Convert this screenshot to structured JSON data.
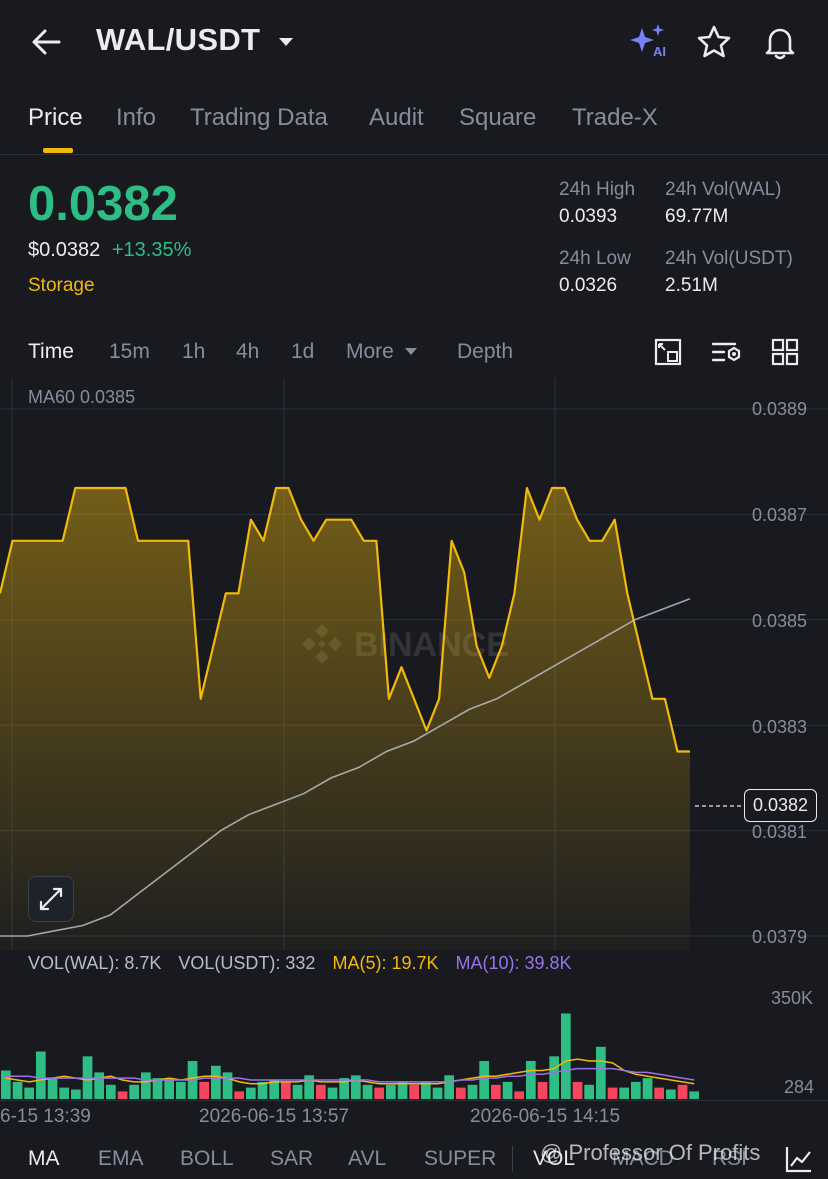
{
  "header": {
    "pair": "WAL/USDT"
  },
  "tabs": [
    "Price",
    "Info",
    "Trading Data",
    "Audit",
    "Square",
    "Trade-X"
  ],
  "ticker": {
    "price": "0.0382",
    "usd_price": "$0.0382",
    "change": "+13.35%",
    "tag": "Storage",
    "high_label": "24h High",
    "high": "0.0393",
    "vol_wal_label": "24h Vol(WAL)",
    "vol_wal": "69.77M",
    "low_label": "24h Low",
    "low": "0.0326",
    "vol_usdt_label": "24h Vol(USDT)",
    "vol_usdt": "2.51M"
  },
  "intervals": [
    "Time",
    "15m",
    "1h",
    "4h",
    "1d",
    "More",
    "Depth"
  ],
  "chart": {
    "ma_label": "MA60 0.0385",
    "watermark": "BINANCE",
    "current_price_label": "0.0382",
    "y_labels": [
      "0.0389",
      "0.0387",
      "0.0385",
      "0.0383",
      "0.0381",
      "0.0379"
    ],
    "vol_labels": [
      "350K",
      "284"
    ],
    "x_labels": [
      "6-15 13:39",
      "2026-06-15 13:57",
      "2026-06-15 14:15"
    ]
  },
  "volume_header": {
    "vol_wal": "VOL(WAL): 8.7K",
    "vol_usdt": "VOL(USDT): 332",
    "ma5": "MA(5): 19.7K",
    "ma10": "MA(10): 39.8K"
  },
  "indicators": [
    "MA",
    "EMA",
    "BOLL",
    "SAR",
    "AVL",
    "SUPER",
    "VOL",
    "MACD",
    "RSI"
  ],
  "watermark_credit": "@ Professor Of Profits",
  "colors": {
    "up": "#2ebd85",
    "down": "#f6465d",
    "accent": "#f0b90b",
    "ma10": "#9a72e8",
    "bg": "#181a20"
  },
  "chart_data": {
    "type": "area",
    "series": [
      {
        "values": [
          0.03855,
          0.03865,
          0.03865,
          0.03865,
          0.03865,
          0.03865,
          0.03875,
          0.03875,
          0.03875,
          0.03875,
          0.03875,
          0.03865,
          0.03865,
          0.03865,
          0.03865,
          0.03865,
          0.03835,
          0.03845,
          0.03855,
          0.03855,
          0.03869,
          0.03865,
          0.03875,
          0.03875,
          0.03869,
          0.03865,
          0.03869,
          0.03869,
          0.03869,
          0.03865,
          0.03865,
          0.03835,
          0.03841,
          0.03835,
          0.03829,
          0.03835,
          0.03865,
          0.03859,
          0.03845,
          0.03839,
          0.03845,
          0.03855,
          0.03875,
          0.03869,
          0.03875,
          0.03875,
          0.03869,
          0.03865,
          0.03865,
          0.03869,
          0.03855,
          0.03845,
          0.03835,
          0.03835,
          0.03825,
          0.03825
        ]
      },
      {
        "name": "MA60",
        "values": [
          0.0379,
          0.0379,
          0.03791,
          0.03792,
          0.03794,
          0.03798,
          0.03802,
          0.03806,
          0.0381,
          0.03813,
          0.03815,
          0.03817,
          0.0382,
          0.03822,
          0.03825,
          0.03827,
          0.0383,
          0.03833,
          0.03835,
          0.03838,
          0.03841,
          0.03844,
          0.03847,
          0.0385,
          0.03852,
          0.03854
        ]
      }
    ],
    "ylim": [
      0.0378,
      0.039
    ],
    "volume": {
      "values": [
        30,
        18,
        12,
        50,
        22,
        12,
        10,
        45,
        28,
        15,
        8,
        15,
        28,
        22,
        22,
        18,
        40,
        18,
        35,
        28,
        8,
        12,
        18,
        20,
        18,
        15,
        25,
        15,
        12,
        22,
        25,
        15,
        12,
        15,
        18,
        15,
        18,
        12,
        25,
        12,
        15,
        40,
        15,
        18,
        8,
        40,
        18,
        45,
        90,
        18,
        15,
        55,
        12,
        12,
        18,
        22,
        12,
        10,
        15,
        8
      ],
      "up": [
        true,
        true,
        true,
        true,
        true,
        true,
        true,
        true,
        true,
        true,
        false,
        true,
        true,
        true,
        true,
        true,
        true,
        false,
        true,
        true,
        false,
        true,
        true,
        true,
        false,
        true,
        true,
        false,
        true,
        true,
        true,
        true,
        false,
        true,
        true,
        false,
        true,
        true,
        true,
        false,
        true,
        true,
        false,
        true,
        false,
        true,
        false,
        true,
        true,
        false,
        true,
        true,
        false,
        true,
        true,
        true,
        false,
        true,
        false,
        true
      ],
      "ma5": [
        22,
        20,
        18,
        20,
        22,
        24,
        22,
        20,
        22,
        24,
        20,
        18,
        18,
        20,
        22,
        20,
        22,
        24,
        24,
        22,
        18,
        16,
        16,
        18,
        18,
        18,
        20,
        18,
        18,
        18,
        20,
        18,
        16,
        16,
        16,
        16,
        16,
        16,
        18,
        20,
        22,
        24,
        24,
        26,
        28,
        30,
        30,
        32,
        40,
        42,
        40,
        40,
        38,
        30,
        26,
        24,
        22,
        20,
        18,
        16
      ],
      "ma10": [
        24,
        24,
        24,
        22,
        22,
        22,
        22,
        22,
        22,
        22,
        22,
        22,
        20,
        20,
        20,
        20,
        20,
        22,
        22,
        22,
        22,
        20,
        20,
        20,
        20,
        20,
        20,
        20,
        20,
        20,
        20,
        20,
        18,
        18,
        18,
        18,
        18,
        18,
        18,
        20,
        20,
        22,
        22,
        24,
        24,
        26,
        26,
        28,
        30,
        32,
        32,
        32,
        32,
        30,
        28,
        28,
        26,
        24,
        22,
        20
      ]
    }
  }
}
